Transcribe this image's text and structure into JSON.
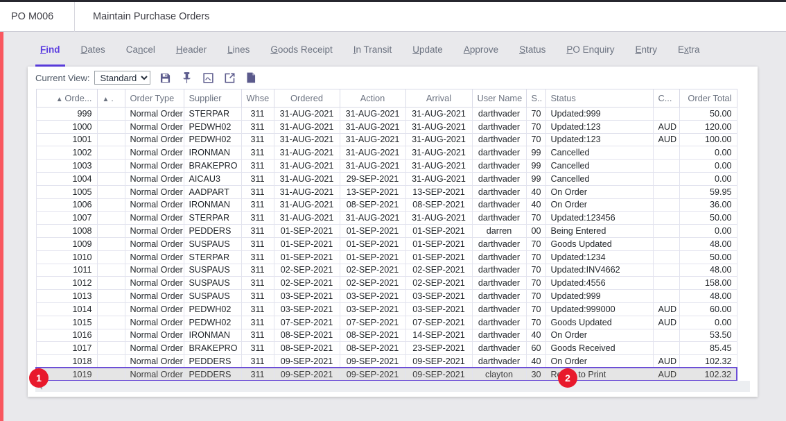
{
  "window": {
    "code": "PO M006",
    "title": "Maintain Purchase Orders"
  },
  "tabs": [
    {
      "label": "Find",
      "accel": "F",
      "active": true
    },
    {
      "label": "Dates",
      "accel": "D",
      "active": false
    },
    {
      "label": "Cancel",
      "accel": "n",
      "active": false
    },
    {
      "label": "Header",
      "accel": "H",
      "active": false
    },
    {
      "label": "Lines",
      "accel": "L",
      "active": false
    },
    {
      "label": "Goods Receipt",
      "accel": "G",
      "active": false
    },
    {
      "label": "In Transit",
      "accel": "I",
      "active": false
    },
    {
      "label": "Update",
      "accel": "U",
      "active": false
    },
    {
      "label": "Approve",
      "accel": "A",
      "active": false
    },
    {
      "label": "Status",
      "accel": "S",
      "active": false
    },
    {
      "label": "PO Enquiry",
      "accel": "P",
      "active": false
    },
    {
      "label": "Entry",
      "accel": "E",
      "active": false
    },
    {
      "label": "Extra",
      "accel": "x",
      "active": false
    }
  ],
  "toolbar": {
    "view_label": "Current View:",
    "view_selected": "Standard",
    "view_options": [
      "Standard"
    ],
    "icons": [
      {
        "name": "save-icon"
      },
      {
        "name": "pin-icon"
      },
      {
        "name": "picture-frame-icon"
      },
      {
        "name": "export-external-link-icon"
      },
      {
        "name": "new-document-icon"
      }
    ]
  },
  "grid": {
    "columns": [
      {
        "key": "order",
        "label": "Orde...",
        "sort": "▲",
        "align": "right"
      },
      {
        "key": "sort2",
        "label": ".",
        "sort": "▲",
        "align": "left"
      },
      {
        "key": "type",
        "label": "Order Type",
        "align": "left"
      },
      {
        "key": "supplier",
        "label": "Supplier",
        "align": "left"
      },
      {
        "key": "whse",
        "label": "Whse",
        "align": "center"
      },
      {
        "key": "ordered",
        "label": "Ordered",
        "align": "center"
      },
      {
        "key": "action",
        "label": "Action",
        "align": "center"
      },
      {
        "key": "arrival",
        "label": "Arrival",
        "align": "center"
      },
      {
        "key": "user",
        "label": "User Name",
        "align": "center"
      },
      {
        "key": "s",
        "label": "S..",
        "align": "left"
      },
      {
        "key": "status",
        "label": "Status",
        "align": "left"
      },
      {
        "key": "c",
        "label": "C...",
        "align": "left"
      },
      {
        "key": "total",
        "label": "Order Total",
        "align": "right"
      }
    ],
    "rows": [
      {
        "order": "999",
        "sort2": "",
        "type": "Normal Order",
        "supplier": "STERPAR",
        "whse": "311",
        "ordered": "31-AUG-2021",
        "action": "31-AUG-2021",
        "arrival": "31-AUG-2021",
        "user": "darthvader",
        "s": "70",
        "status": "Updated:999",
        "c": "",
        "total": "50.00",
        "selected": false
      },
      {
        "order": "1000",
        "sort2": "",
        "type": "Normal Order",
        "supplier": "PEDWH02",
        "whse": "311",
        "ordered": "31-AUG-2021",
        "action": "31-AUG-2021",
        "arrival": "31-AUG-2021",
        "user": "darthvader",
        "s": "70",
        "status": "Updated:123",
        "c": "AUD",
        "total": "120.00",
        "selected": false
      },
      {
        "order": "1001",
        "sort2": "",
        "type": "Normal Order",
        "supplier": "PEDWH02",
        "whse": "311",
        "ordered": "31-AUG-2021",
        "action": "31-AUG-2021",
        "arrival": "31-AUG-2021",
        "user": "darthvader",
        "s": "70",
        "status": "Updated:123",
        "c": "AUD",
        "total": "100.00",
        "selected": false
      },
      {
        "order": "1002",
        "sort2": "",
        "type": "Normal Order",
        "supplier": "IRONMAN",
        "whse": "311",
        "ordered": "31-AUG-2021",
        "action": "31-AUG-2021",
        "arrival": "31-AUG-2021",
        "user": "darthvader",
        "s": "99",
        "status": "Cancelled",
        "c": "",
        "total": "0.00",
        "selected": false
      },
      {
        "order": "1003",
        "sort2": "",
        "type": "Normal Order",
        "supplier": "BRAKEPRO",
        "whse": "311",
        "ordered": "31-AUG-2021",
        "action": "31-AUG-2021",
        "arrival": "31-AUG-2021",
        "user": "darthvader",
        "s": "99",
        "status": "Cancelled",
        "c": "",
        "total": "0.00",
        "selected": false
      },
      {
        "order": "1004",
        "sort2": "",
        "type": "Normal Order",
        "supplier": "AICAU3",
        "whse": "311",
        "ordered": "31-AUG-2021",
        "action": "29-SEP-2021",
        "arrival": "31-AUG-2021",
        "user": "darthvader",
        "s": "99",
        "status": "Cancelled",
        "c": "",
        "total": "0.00",
        "selected": false
      },
      {
        "order": "1005",
        "sort2": "",
        "type": "Normal Order",
        "supplier": "AADPART",
        "whse": "311",
        "ordered": "31-AUG-2021",
        "action": "13-SEP-2021",
        "arrival": "13-SEP-2021",
        "user": "darthvader",
        "s": "40",
        "status": "On Order",
        "c": "",
        "total": "59.95",
        "selected": false
      },
      {
        "order": "1006",
        "sort2": "",
        "type": "Normal Order",
        "supplier": "IRONMAN",
        "whse": "311",
        "ordered": "31-AUG-2021",
        "action": "08-SEP-2021",
        "arrival": "08-SEP-2021",
        "user": "darthvader",
        "s": "40",
        "status": "On Order",
        "c": "",
        "total": "36.00",
        "selected": false
      },
      {
        "order": "1007",
        "sort2": "",
        "type": "Normal Order",
        "supplier": "STERPAR",
        "whse": "311",
        "ordered": "31-AUG-2021",
        "action": "31-AUG-2021",
        "arrival": "31-AUG-2021",
        "user": "darthvader",
        "s": "70",
        "status": "Updated:123456",
        "c": "",
        "total": "50.00",
        "selected": false
      },
      {
        "order": "1008",
        "sort2": "",
        "type": "Normal Order",
        "supplier": "PEDDERS",
        "whse": "311",
        "ordered": "01-SEP-2021",
        "action": "01-SEP-2021",
        "arrival": "01-SEP-2021",
        "user": "darren",
        "s": "00",
        "status": "Being Entered",
        "c": "",
        "total": "0.00",
        "selected": false
      },
      {
        "order": "1009",
        "sort2": "",
        "type": "Normal Order",
        "supplier": "SUSPAUS",
        "whse": "311",
        "ordered": "01-SEP-2021",
        "action": "01-SEP-2021",
        "arrival": "01-SEP-2021",
        "user": "darthvader",
        "s": "70",
        "status": "Goods Updated",
        "c": "",
        "total": "48.00",
        "selected": false
      },
      {
        "order": "1010",
        "sort2": "",
        "type": "Normal Order",
        "supplier": "STERPAR",
        "whse": "311",
        "ordered": "01-SEP-2021",
        "action": "01-SEP-2021",
        "arrival": "01-SEP-2021",
        "user": "darthvader",
        "s": "70",
        "status": "Updated:1234",
        "c": "",
        "total": "50.00",
        "selected": false
      },
      {
        "order": "1011",
        "sort2": "",
        "type": "Normal Order",
        "supplier": "SUSPAUS",
        "whse": "311",
        "ordered": "02-SEP-2021",
        "action": "02-SEP-2021",
        "arrival": "02-SEP-2021",
        "user": "darthvader",
        "s": "70",
        "status": "Updated:INV4662",
        "c": "",
        "total": "48.00",
        "selected": false
      },
      {
        "order": "1012",
        "sort2": "",
        "type": "Normal Order",
        "supplier": "SUSPAUS",
        "whse": "311",
        "ordered": "02-SEP-2021",
        "action": "02-SEP-2021",
        "arrival": "02-SEP-2021",
        "user": "darthvader",
        "s": "70",
        "status": "Updated:4556",
        "c": "",
        "total": "158.00",
        "selected": false
      },
      {
        "order": "1013",
        "sort2": "",
        "type": "Normal Order",
        "supplier": "SUSPAUS",
        "whse": "311",
        "ordered": "03-SEP-2021",
        "action": "03-SEP-2021",
        "arrival": "03-SEP-2021",
        "user": "darthvader",
        "s": "70",
        "status": "Updated:999",
        "c": "",
        "total": "48.00",
        "selected": false
      },
      {
        "order": "1014",
        "sort2": "",
        "type": "Normal Order",
        "supplier": "PEDWH02",
        "whse": "311",
        "ordered": "03-SEP-2021",
        "action": "03-SEP-2021",
        "arrival": "03-SEP-2021",
        "user": "darthvader",
        "s": "70",
        "status": "Updated:999000",
        "c": "AUD",
        "total": "60.00",
        "selected": false
      },
      {
        "order": "1015",
        "sort2": "",
        "type": "Normal Order",
        "supplier": "PEDWH02",
        "whse": "311",
        "ordered": "07-SEP-2021",
        "action": "07-SEP-2021",
        "arrival": "07-SEP-2021",
        "user": "darthvader",
        "s": "70",
        "status": "Goods Updated",
        "c": "AUD",
        "total": "0.00",
        "selected": false
      },
      {
        "order": "1016",
        "sort2": "",
        "type": "Normal Order",
        "supplier": "IRONMAN",
        "whse": "311",
        "ordered": "08-SEP-2021",
        "action": "08-SEP-2021",
        "arrival": "14-SEP-2021",
        "user": "darthvader",
        "s": "40",
        "status": "On Order",
        "c": "",
        "total": "53.50",
        "selected": false
      },
      {
        "order": "1017",
        "sort2": "",
        "type": "Normal Order",
        "supplier": "BRAKEPRO",
        "whse": "311",
        "ordered": "08-SEP-2021",
        "action": "08-SEP-2021",
        "arrival": "23-SEP-2021",
        "user": "darthvader",
        "s": "60",
        "status": "Goods Received",
        "c": "",
        "total": "85.45",
        "selected": false
      },
      {
        "order": "1018",
        "sort2": "",
        "type": "Normal Order",
        "supplier": "PEDDERS",
        "whse": "311",
        "ordered": "09-SEP-2021",
        "action": "09-SEP-2021",
        "arrival": "09-SEP-2021",
        "user": "darthvader",
        "s": "40",
        "status": "On Order",
        "c": "AUD",
        "total": "102.32",
        "selected": false
      },
      {
        "order": "1019",
        "sort2": "",
        "type": "Normal Order",
        "supplier": "PEDDERS",
        "whse": "311",
        "ordered": "09-SEP-2021",
        "action": "09-SEP-2021",
        "arrival": "09-SEP-2021",
        "user": "clayton",
        "s": "30",
        "status": "Ready to Print",
        "c": "AUD",
        "total": "102.32",
        "selected": true
      }
    ]
  },
  "annotations": [
    {
      "label": "1"
    },
    {
      "label": "2"
    }
  ],
  "colors": {
    "accent": "#5b3de0",
    "left_strip": "#f9575f",
    "selection_border": "#6c4fd6",
    "annotation": "#e8192c"
  }
}
